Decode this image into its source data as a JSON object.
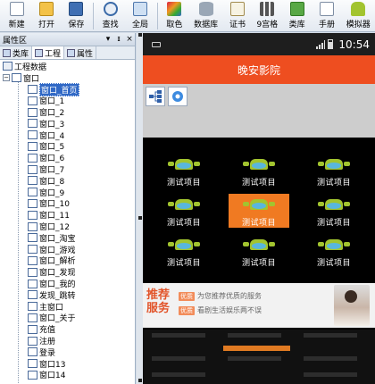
{
  "toolbar": {
    "buttons": [
      {
        "label": "新建",
        "icon": "new-file-icon"
      },
      {
        "label": "打开",
        "icon": "open-folder-icon"
      },
      {
        "label": "保存",
        "icon": "save-icon"
      },
      {
        "label": "查找",
        "icon": "search-icon"
      },
      {
        "label": "全局",
        "icon": "global-icon"
      },
      {
        "label": "取色",
        "icon": "color-picker-icon"
      },
      {
        "label": "数据库",
        "icon": "database-icon"
      },
      {
        "label": "证书",
        "icon": "certificate-icon"
      },
      {
        "label": "9宫格",
        "icon": "grid-icon"
      },
      {
        "label": "类库",
        "icon": "library-icon"
      },
      {
        "label": "手册",
        "icon": "manual-icon"
      },
      {
        "label": "模拟器",
        "icon": "emulator-icon"
      }
    ]
  },
  "left_panel": {
    "title": "属性区",
    "controls": [
      "▾",
      "ᵻ",
      "×"
    ],
    "tabs": [
      "类库",
      "工程",
      "属性"
    ],
    "active_tab": "工程",
    "tree": {
      "root": "工程数据",
      "group": "窗口",
      "items": [
        "窗口_首页",
        "窗口_1",
        "窗口_2",
        "窗口_3",
        "窗口_4",
        "窗口_5",
        "窗口_6",
        "窗口_7",
        "窗口_8",
        "窗口_9",
        "窗口_10",
        "窗口_11",
        "窗口_12",
        "窗口_淘宝",
        "窗口_游戏",
        "窗口_解析",
        "窗口_发现",
        "窗口_我的",
        "发现_跳转",
        "主窗口",
        "窗口_关于",
        "充值",
        "注册",
        "登录",
        "窗口13",
        "窗口14"
      ],
      "selected": "窗口_首页"
    }
  },
  "phone": {
    "status_time": "10:54",
    "app_title": "晚安影院",
    "grid_items": [
      "测试项目",
      "测试项目",
      "测试项目",
      "测试项目",
      "测试项目",
      "测试项目",
      "测试项目",
      "测试项目",
      "测试项目"
    ],
    "highlight_index": 4,
    "promo": {
      "title": "推荐服务",
      "line1_badge": "优质",
      "line1_text": "为您推荐优质的服务",
      "line2_badge": "优质",
      "line2_text": "看剧生活娱乐两不误"
    }
  },
  "colors": {
    "header_orange": "#ee4e20",
    "highlight_orange": "#f07a22",
    "android_green": "#a2c42f",
    "selection_blue": "#3169c6"
  }
}
